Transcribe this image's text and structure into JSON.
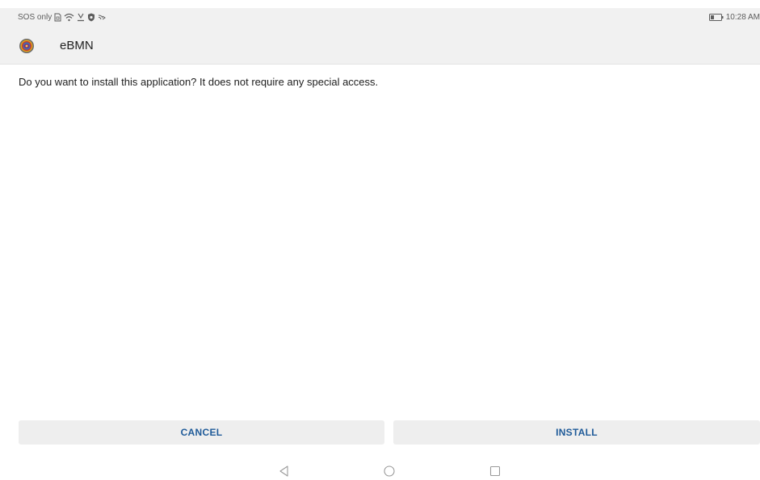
{
  "status_bar": {
    "carrier_text": "SOS only",
    "time": "10:28 AM",
    "icons": [
      "sim-card-icon",
      "wifi-icon",
      "download-icon",
      "shield-icon",
      "cast-icon",
      "battery-icon"
    ]
  },
  "header": {
    "app_name": "eBMN",
    "app_icon": "app-logo-icon"
  },
  "main": {
    "message": "Do you want to install this application? It does not require any special access."
  },
  "buttons": {
    "cancel": "CANCEL",
    "install": "INSTALL"
  },
  "nav_bar": {
    "icons": [
      "back-icon",
      "home-icon",
      "recents-icon"
    ]
  },
  "colors": {
    "accent": "#1f5b99",
    "header_bg": "#f1f1f1",
    "button_bg": "#eeeeee"
  }
}
